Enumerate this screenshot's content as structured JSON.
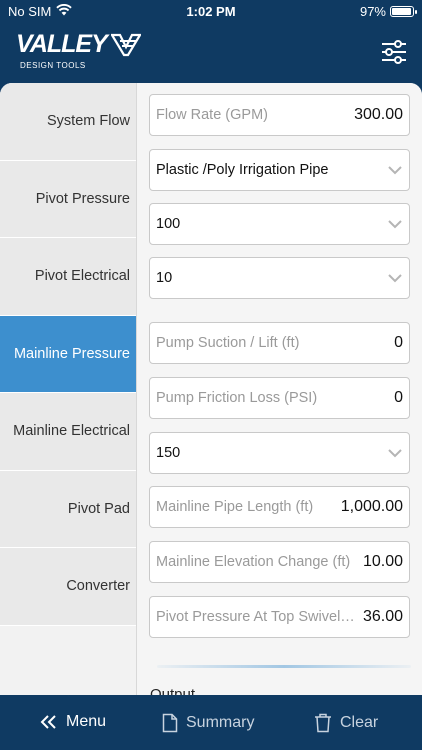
{
  "status_bar": {
    "carrier": "No SIM",
    "time": "1:02 PM",
    "battery": "97%"
  },
  "header": {
    "brand": "VALLEY",
    "subtitle": "DESIGN TOOLS"
  },
  "sidebar": {
    "items": [
      {
        "label": "System Flow"
      },
      {
        "label": "Pivot Pressure"
      },
      {
        "label": "Pivot Electrical"
      },
      {
        "label": "Mainline Pressure"
      },
      {
        "label": "Mainline Electrical"
      },
      {
        "label": "Pivot Pad"
      },
      {
        "label": "Converter"
      }
    ],
    "active": "Mainline Pressure"
  },
  "form": {
    "flow_rate": {
      "label": "Flow Rate (GPM)",
      "value": "300.00"
    },
    "pipe_type": {
      "selected": "Plastic /Poly Irrigation Pipe"
    },
    "pipe_class": {
      "selected": "100"
    },
    "pipe_size": {
      "selected": "10"
    },
    "pump_suction": {
      "label": "Pump Suction / Lift (ft)",
      "value": "0"
    },
    "pump_friction": {
      "label": "Pump Friction Loss (PSI)",
      "value": "0"
    },
    "hz_select": {
      "selected": "150"
    },
    "mainline_length": {
      "label": "Mainline Pipe Length (ft)",
      "value": "1,000.00"
    },
    "elevation_change": {
      "label": "Mainline Elevation Change (ft)",
      "value": "10.00"
    },
    "pivot_pressure_top": {
      "label": "Pivot Pressure At Top Swivel (PSI)",
      "value": "36.00"
    },
    "output_label": "Output"
  },
  "bottom_bar": {
    "menu": "Menu",
    "summary": "Summary",
    "clear": "Clear"
  },
  "colors": {
    "navy": "#0f3a62",
    "accent": "#3d8fce"
  }
}
